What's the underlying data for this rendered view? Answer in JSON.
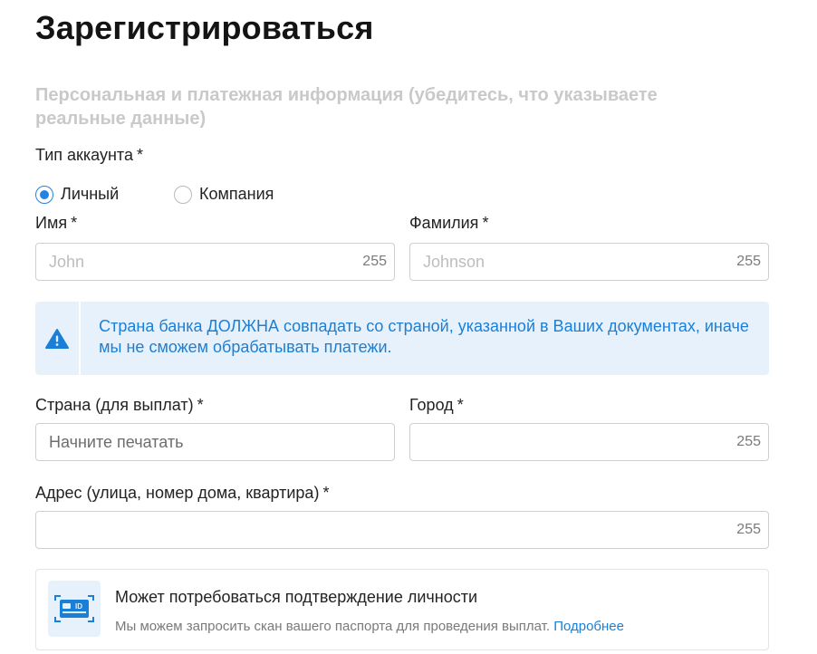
{
  "page": {
    "title": "Зарегистрироваться",
    "subtitle": "Персональная и платежная информация (убедитесь, что указываете реальные данные)"
  },
  "account_type": {
    "label": "Тип аккаунта",
    "required_mark": "*",
    "options": [
      {
        "label": "Личный",
        "selected": true
      },
      {
        "label": "Компания",
        "selected": false
      }
    ]
  },
  "first_name": {
    "label": "Имя",
    "required_mark": "*",
    "placeholder": "John",
    "counter": "255"
  },
  "last_name": {
    "label": "Фамилия",
    "required_mark": "*",
    "placeholder": "Johnson",
    "counter": "255"
  },
  "alert": {
    "text": "Страна банка ДОЛЖНА совпадать со страной, указанной в Ваших документах, иначе мы не сможем обрабатывать платежи.",
    "icon": "warning-icon",
    "color": "#1a7fd6",
    "background": "#e7f1fb"
  },
  "country": {
    "label": "Страна (для выплат)",
    "required_mark": "*",
    "placeholder": "Начните печатать"
  },
  "city": {
    "label": "Город",
    "required_mark": "*",
    "placeholder": "",
    "counter": "255"
  },
  "address": {
    "label": "Адрес (улица, номер дома, квартира)",
    "required_mark": "*",
    "placeholder": "",
    "counter": "255"
  },
  "identity_notice": {
    "title": "Может потребоваться подтверждение личности",
    "text": "Мы можем запросить скан вашего паспорта для проведения выплат.",
    "link": "Подробнее",
    "icon": "id-card-icon",
    "icon_text": "ID"
  },
  "colors": {
    "accent": "#2582e0",
    "link": "#1a7fd6"
  }
}
